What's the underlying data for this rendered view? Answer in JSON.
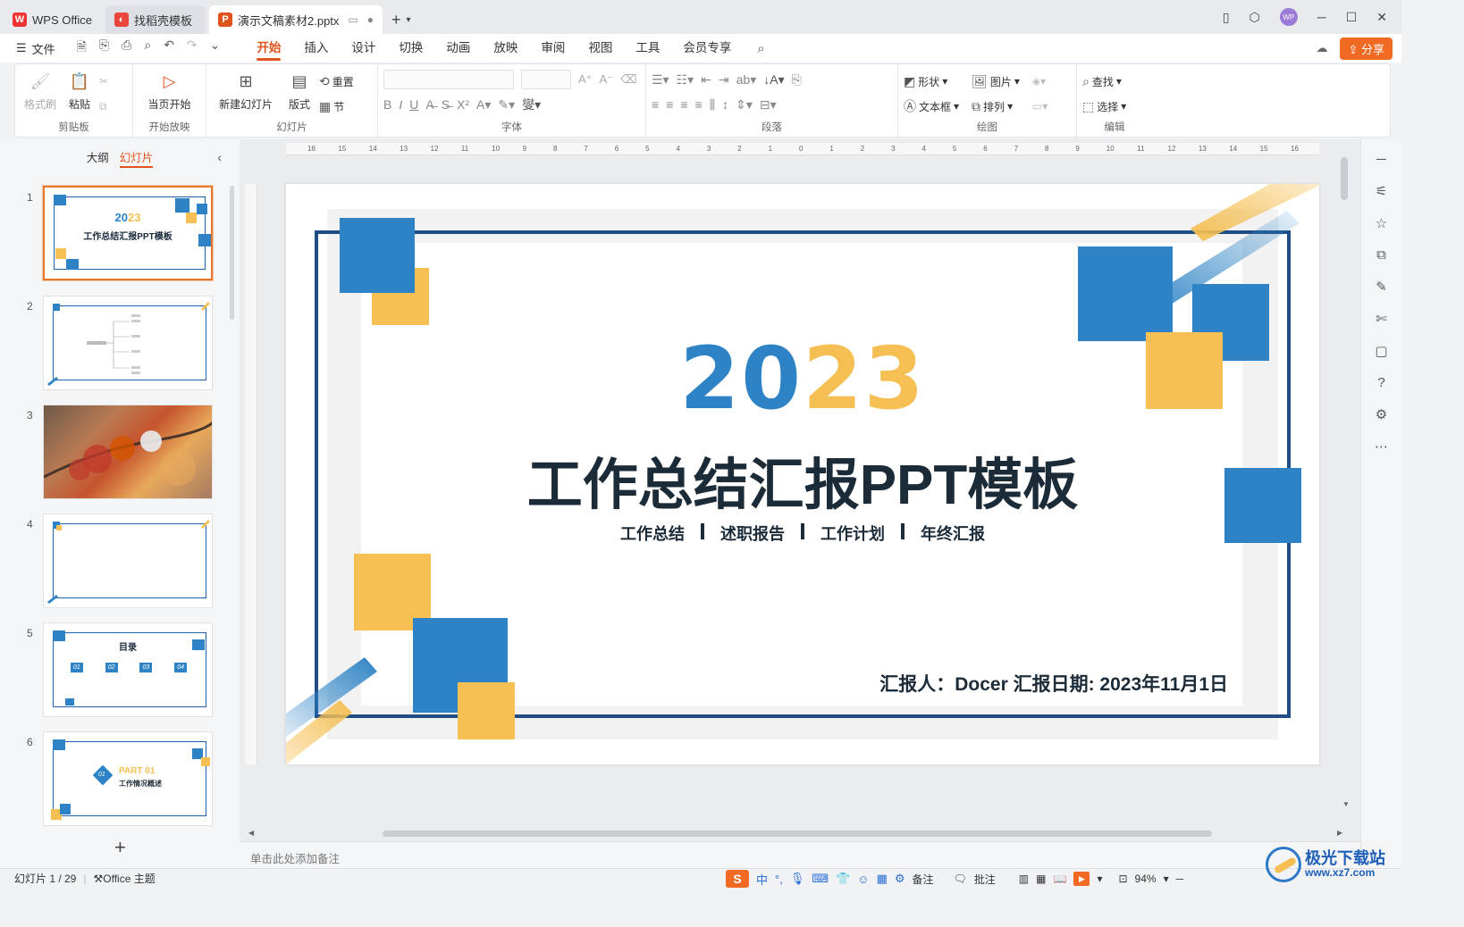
{
  "titlebar": {
    "tabs": [
      {
        "label": "WPS Office",
        "icon": "wps-logo-icon"
      },
      {
        "label": "找稻壳模板",
        "icon": "docer-icon"
      },
      {
        "label": "演示文稿素材2.pptx",
        "icon": "ppt-file-icon"
      }
    ],
    "avatar_text": "WP"
  },
  "menubar": {
    "file_label": "文件",
    "tabs": [
      "开始",
      "插入",
      "设计",
      "切换",
      "动画",
      "放映",
      "审阅",
      "视图",
      "工具",
      "会员专享"
    ],
    "active_tab": "开始",
    "share_label": "分享"
  },
  "ribbon": {
    "clipboard": {
      "format_painter": "格式刷",
      "paste": "粘贴",
      "group": "剪贴板"
    },
    "slideshow": {
      "from_current": "当页开始",
      "group": "开始放映"
    },
    "slides": {
      "new_slide": "新建幻灯片",
      "layout": "版式",
      "reset": "重置",
      "section": "节",
      "group": "幻灯片"
    },
    "font": {
      "group": "字体"
    },
    "paragraph": {
      "group": "段落"
    },
    "drawing": {
      "shape": "形状",
      "picture": "图片",
      "textbox": "文本框",
      "arrange": "排列",
      "group": "绘图"
    },
    "editing": {
      "find": "查找",
      "select": "选择",
      "group": "编辑"
    }
  },
  "leftpane": {
    "tabs": [
      "大纲",
      "幻灯片"
    ],
    "active_tab": "幻灯片",
    "slides": [
      {
        "num": "1",
        "year": "2023",
        "title": "工作总结汇报PPT模板"
      },
      {
        "num": "2"
      },
      {
        "num": "3"
      },
      {
        "num": "4"
      },
      {
        "num": "5",
        "title": "目录",
        "items": [
          "01",
          "02",
          "03",
          "04"
        ]
      },
      {
        "num": "6",
        "part": "PART 01",
        "subtitle": "工作情况概述",
        "badge": "01"
      }
    ]
  },
  "slide": {
    "year_left": "20",
    "year_right": "23",
    "title": "工作总结汇报PPT模板",
    "subtitle_items": [
      "工作总结",
      "述职报告",
      "工作计划",
      "年终汇报"
    ],
    "reporter": "汇报人：Docer  汇报日期: 2023年11月1日",
    "colors": {
      "blue": "#2d83c5",
      "yellow": "#f5bf53",
      "navy": "#1f4e86"
    }
  },
  "ruler_h": [
    "16",
    "15",
    "14",
    "13",
    "12",
    "11",
    "10",
    "9",
    "8",
    "7",
    "6",
    "5",
    "4",
    "3",
    "2",
    "1",
    "0",
    "1",
    "2",
    "3",
    "4",
    "5",
    "6",
    "7",
    "8",
    "9",
    "10",
    "11",
    "12",
    "13",
    "14",
    "15",
    "16"
  ],
  "notes_placeholder": "单击此处添加备注",
  "statusbar": {
    "slide_info": "幻灯片 1 / 29",
    "theme": "Office 主题",
    "notes": "备注",
    "comments": "批注",
    "zoom": "94%"
  },
  "ime": {
    "s": "S",
    "lang": "中"
  },
  "watermark": {
    "line1": "极光下载站",
    "line2": "www.xz7.com"
  }
}
